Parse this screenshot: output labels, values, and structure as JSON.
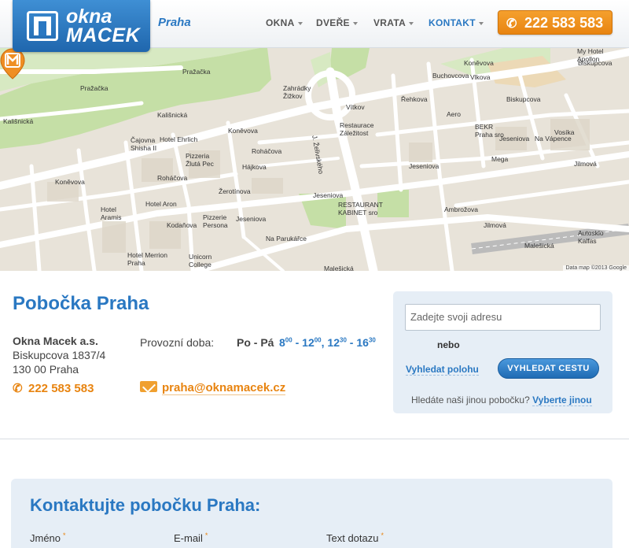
{
  "header": {
    "logo_line1": "okna",
    "logo_line2": "MACEK",
    "city": "Praha",
    "nav": [
      {
        "label": "OKNA",
        "active": false
      },
      {
        "label": "DVEŘE",
        "active": false
      },
      {
        "label": "VRATA",
        "active": false
      },
      {
        "label": "KONTAKT",
        "active": true
      }
    ],
    "phone": "222 583 583",
    "phone_icon": "phone-icon"
  },
  "map": {
    "labels": [
      "Pražačka",
      "Pražačka",
      "Kališnická",
      "Kališnická",
      "Čajovna Shisha II",
      "Hotel Ehrlich",
      "Pizzeria Žlutá Pec",
      "Koněvova",
      "Koněvova",
      "Koněvova",
      "Roháčova",
      "Roháčova",
      "Hájkova",
      "Žerotínova",
      "Hotel Aron",
      "Hotel Aramis",
      "Pizzerie Persona",
      "Kodaňova",
      "Hotel Merrion Praha",
      "Unicorn College",
      "Na Parukářce",
      "Jeseniova",
      "Jeseniova",
      "Jeseniova",
      "Jeseniova",
      "RESTAURANT KABINET sro",
      "Zahrádky Žižkov",
      "Vítkov",
      "Restaurace Záležitost",
      "Řehkova",
      "Aero",
      "Buchovcova",
      "Vlkova",
      "Biskupcova",
      "BEKR Praha sro",
      "Mega",
      "Ambrožova",
      "Jilmová",
      "Jilmová",
      "Na Vápence",
      "Vosíka",
      "My Hotel Apollon",
      "Autosklo Kalfas",
      "Malešická",
      "Malešická",
      "J. Želivského",
      "Biskupcova"
    ],
    "credit": "Data map ©2013 Google"
  },
  "branch": {
    "title": "Pobočka Praha",
    "company": "Okna Macek a.s.",
    "street": "Biskupcova 1837/4",
    "city": "130 00 Praha",
    "phone": "222 583 583",
    "hours_label": "Provozní doba:",
    "hours_days": "Po - Pá",
    "hours_h1": "8",
    "hours_m1": "00",
    "hours_h2": "12",
    "hours_m2": "00",
    "hours_h3": "12",
    "hours_m3": "30",
    "hours_h4": "16",
    "hours_m4": "30",
    "email": "praha@oknamacek.cz"
  },
  "route": {
    "placeholder": "Zadejte svoji adresu",
    "or": "nebo",
    "find_position": "Vyhledat polohu",
    "find_route": "VYHLEDAT CESTU",
    "other_branch_q": "Hledáte naši jinou pobočku?",
    "other_branch_link": "Vyberte jinou"
  },
  "contact": {
    "title": "Kontaktujte pobočku Praha:",
    "fields": [
      "Jméno",
      "E-mail",
      "Text dotazu"
    ],
    "required_mark": "*"
  }
}
